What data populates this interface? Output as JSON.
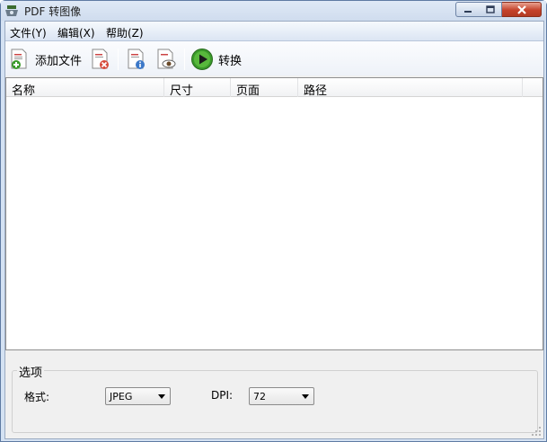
{
  "window": {
    "title": "PDF 转图像"
  },
  "menu": {
    "items": [
      "文件(Y)",
      "编辑(X)",
      "帮助(Z)"
    ]
  },
  "toolbar": {
    "add_file_label": "添加文件",
    "convert_label": "转换"
  },
  "file_list": {
    "columns": [
      "名称",
      "尺寸",
      "页面",
      "路径"
    ],
    "rows": []
  },
  "options": {
    "group_title": "选项",
    "format_label": "格式:",
    "format_value": "JPEG",
    "dpi_label": "DPI:",
    "dpi_value": "72"
  },
  "colors": {
    "accent_green": "#3a9a2a",
    "close_red": "#c5432c"
  }
}
